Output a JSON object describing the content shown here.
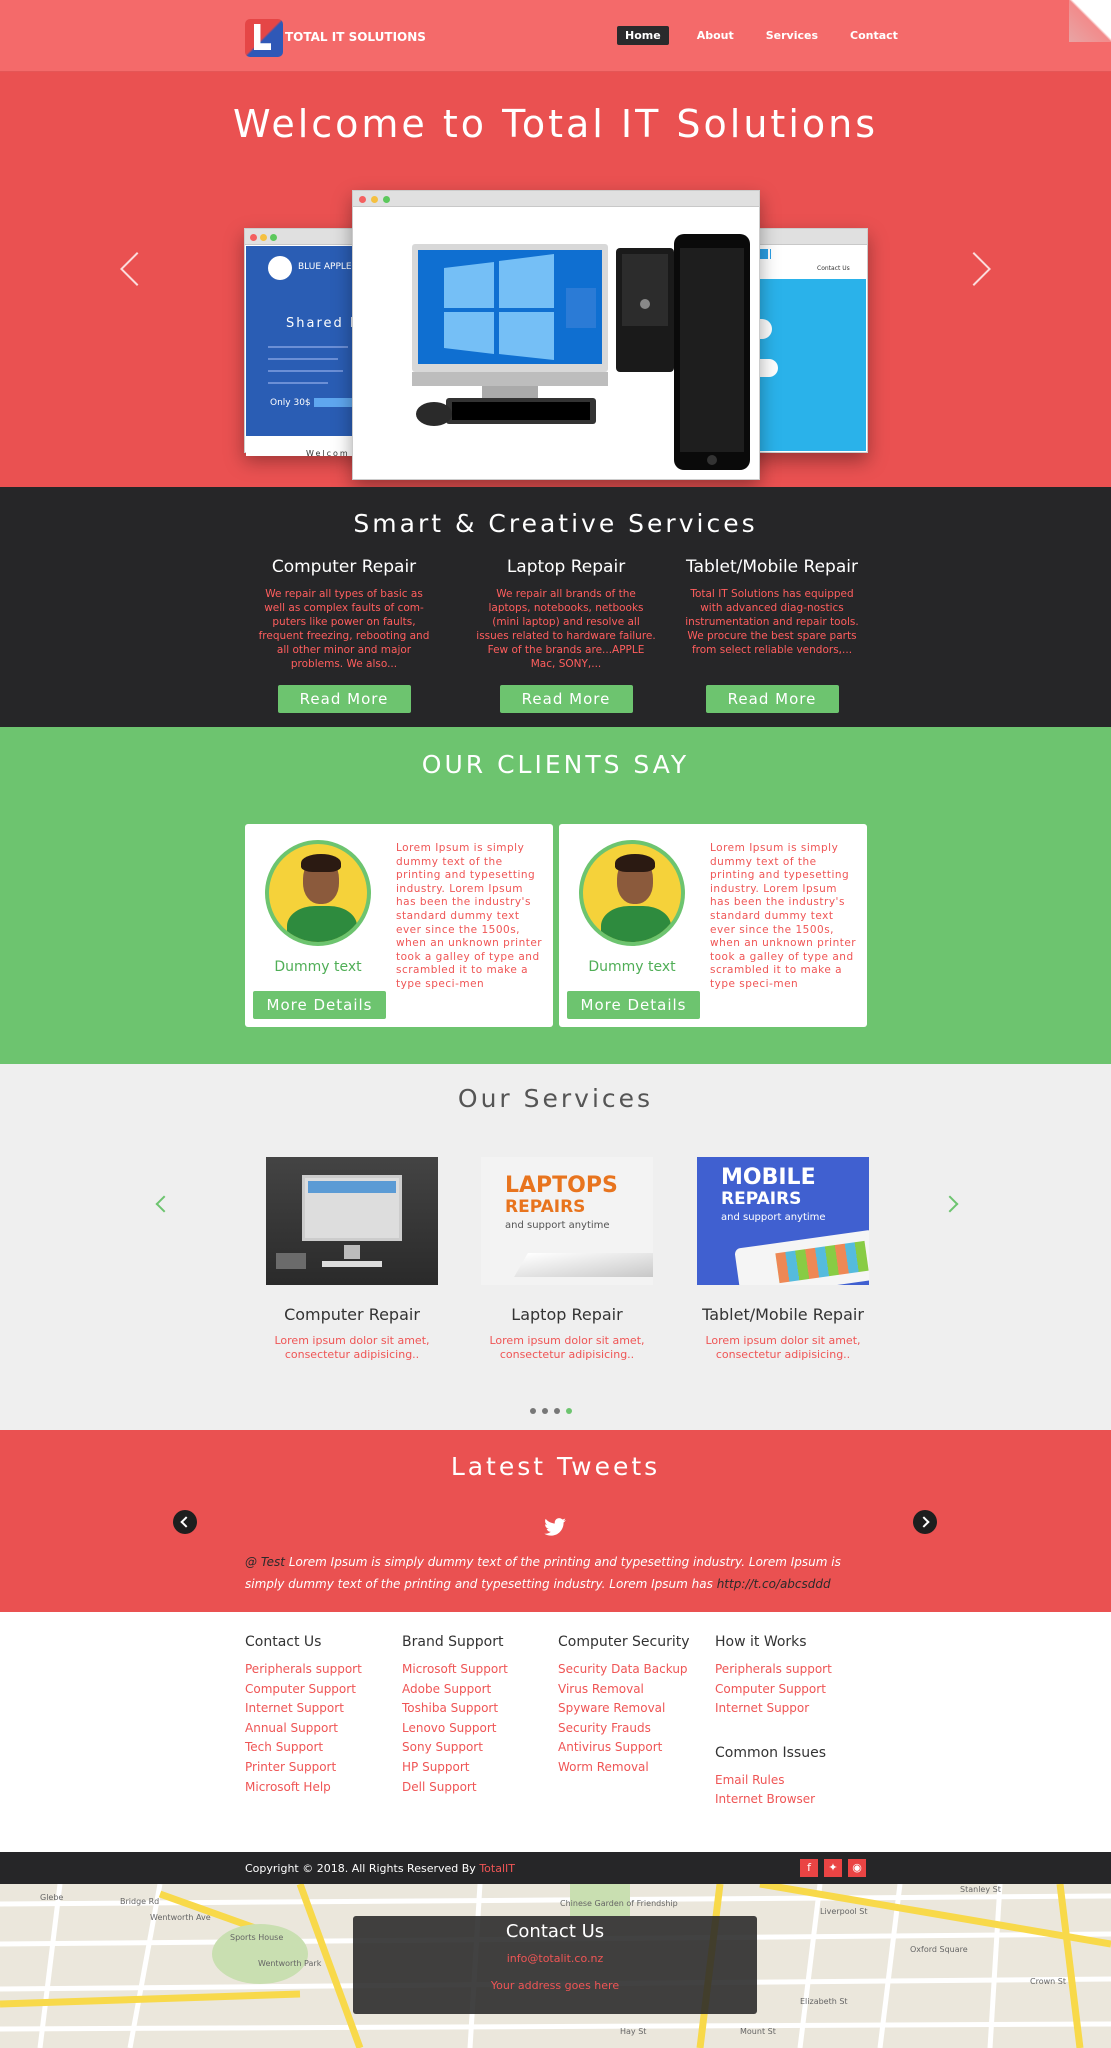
{
  "brand": {
    "name": "TOTAL IT SOLUTIONS"
  },
  "nav": {
    "items": [
      "Home",
      "About",
      "Services",
      "Contact"
    ],
    "active": "Home"
  },
  "hero": {
    "title": "Welcome to Total IT Solutions",
    "left_screen": {
      "brand": "BLUE APPLE",
      "heading": "Shared Ho",
      "price": "Only 30$",
      "footer": "Welcom"
    },
    "right_screen": {
      "nav": "Contact Us"
    }
  },
  "smart": {
    "title": "Smart & Creative Services",
    "columns": [
      {
        "title": "Computer Repair",
        "text": "We repair all types of basic as well as complex faults of com-puters like power on faults, frequent freezing, rebooting and all other minor and major problems. We also...",
        "button": "Read More"
      },
      {
        "title": "Laptop Repair",
        "text": "We repair all brands of the laptops, notebooks, netbooks (mini laptop) and resolve all issues related to hardware failure. Few of the brands are...APPLE Mac, SONY,...",
        "button": "Read More"
      },
      {
        "title": "Tablet/Mobile Repair",
        "text": "Total IT Solutions has equipped with advanced diag-nostics instrumentation and repair tools. We procure the best spare parts from select reliable vendors,...",
        "button": "Read More"
      }
    ]
  },
  "clients": {
    "title": "OUR CLIENTS SAY",
    "cards": [
      {
        "name": "Dummy text",
        "quote": "Lorem Ipsum is simply dummy text of the printing and typesetting industry. Lorem Ipsum has been the industry's standard dummy text ever since the 1500s, when an unknown printer took a galley of type and scrambled it to make a type speci-men",
        "button": "More Details"
      },
      {
        "name": "Dummy text",
        "quote": "Lorem Ipsum is simply dummy text of the printing and typesetting industry. Lorem Ipsum has been the industry's standard dummy text ever since the 1500s, when an unknown printer took a galley of type and scrambled it to make a type speci-men",
        "button": "More Details"
      }
    ]
  },
  "our_services": {
    "title": "Our Services",
    "items": [
      {
        "title": "Computer Repair",
        "text": "Lorem ipsum dolor sit amet, consectetur adipisicing..",
        "thumb": {}
      },
      {
        "title": "Laptop Repair",
        "text": "Lorem ipsum dolor sit amet, consectetur adipisicing..",
        "thumb": {
          "line1": "LAPTOPS",
          "line2": "REPAIRS",
          "line3": "and support anytime"
        }
      },
      {
        "title": "Tablet/Mobile Repair",
        "text": "Lorem ipsum dolor sit amet, consectetur adipisicing..",
        "thumb": {
          "line1": "MOBILE",
          "line2": "REPAIRS",
          "line3": "and support anytime"
        }
      }
    ],
    "active_dot": 4
  },
  "tweets": {
    "title": "Latest Tweets",
    "handle": "@ Test",
    "text": " Lorem Ipsum is simply dummy text of the printing and typesetting industry. Lorem Ipsum is simply dummy text of the printing and typesetting industry. Lorem Ipsum has ",
    "link": "http://t.co/abcsddd"
  },
  "footer_links": {
    "contact_us": {
      "title": "Contact Us",
      "items": [
        "Peripherals support",
        "Computer Support",
        "Internet Support",
        "Annual Support",
        "Tech Support",
        "Printer Support",
        "Microsoft Help"
      ]
    },
    "brand_support": {
      "title": "Brand Support",
      "items": [
        "Microsoft Support",
        "Adobe Support",
        "Toshiba Support",
        "Lenovo Support",
        "Sony Support",
        "HP Support",
        "Dell Support"
      ]
    },
    "computer_security": {
      "title": "Computer Security",
      "items": [
        "Security Data Backup",
        "Virus Removal",
        "Spyware Removal",
        "Security Frauds",
        "Antivirus Support",
        "Worm Removal"
      ]
    },
    "how_it_works": {
      "title": "How it Works",
      "items": [
        "Peripherals support",
        "Computer Support",
        "Internet Suppor"
      ]
    },
    "common_issues": {
      "title": "Common Issues",
      "items": [
        "Email Rules",
        "Internet Browser"
      ]
    }
  },
  "copyright": {
    "text": "Copyright © 2018. All Rights Reserved By ",
    "brand": "TotalIT"
  },
  "social": [
    "facebook-icon",
    "twitter-icon",
    "rss-icon"
  ],
  "map": {
    "labels": [
      "Bridge Rd",
      "Glebe",
      "Wentworth Park",
      "Sports House",
      "Chinese Garden of Friendship",
      "Liverpool St",
      "Stanley St",
      "Oxford Square",
      "Crown St",
      "Hay St",
      "Mount St",
      "Elizabeth St",
      "Wentworth Ave"
    ],
    "contact": {
      "title": "Contact Us",
      "email": "info@totalit.co.nz",
      "address": "Your address goes here"
    }
  },
  "colors": {
    "red": "#ea5151",
    "dark": "#262628",
    "green": "#6dc46f",
    "light": "#efefef",
    "link_red": "#ef5555"
  }
}
